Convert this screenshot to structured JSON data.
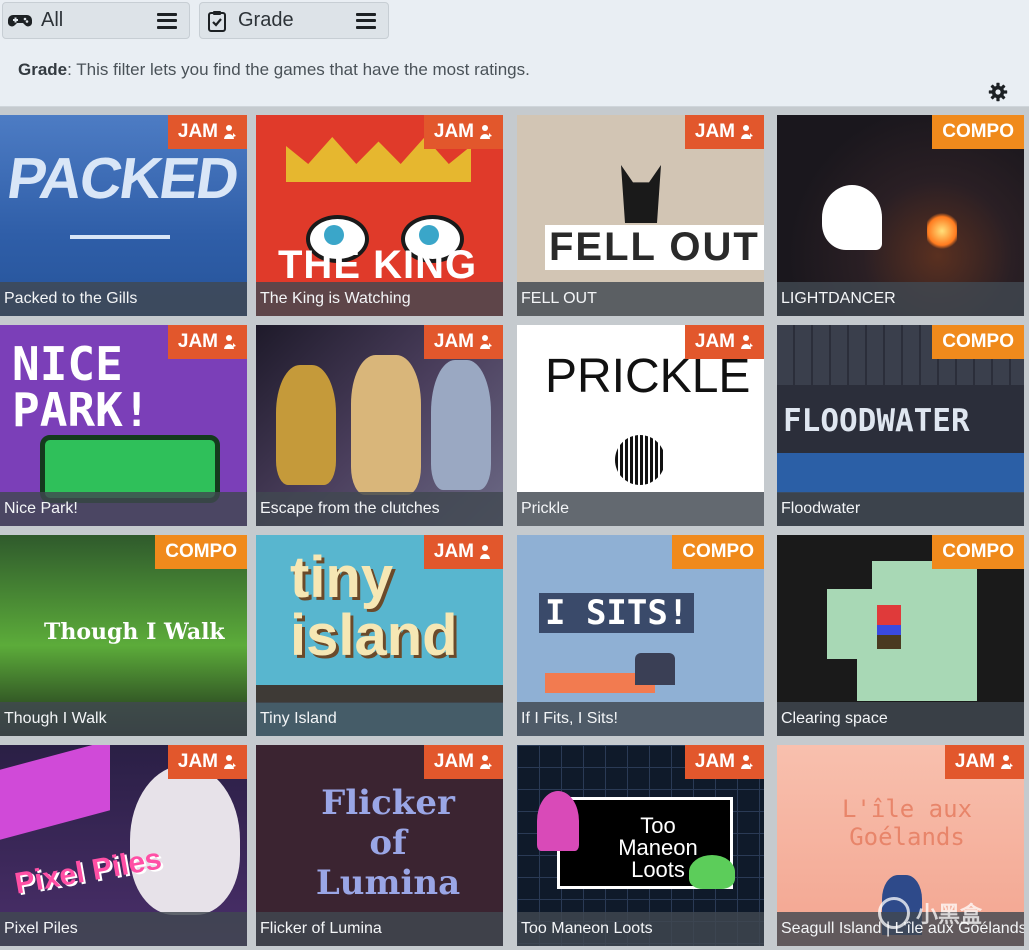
{
  "filters": {
    "platform": {
      "label": "All",
      "icon": "gamepad-icon"
    },
    "sort": {
      "label": "Grade",
      "icon": "clipboard-check-icon"
    }
  },
  "description": {
    "term": "Grade",
    "text": ": This filter lets you find the games that have the most ratings."
  },
  "colors": {
    "jam": "#e2572c",
    "compo": "#f08a1c",
    "caption_bg": "#414850",
    "topbar_bg": "#e9eef3"
  },
  "games": [
    {
      "title": "Packed to the Gills",
      "badge": "JAM",
      "art": "PACKED",
      "bg": "#3e6cb2"
    },
    {
      "title": "The King is Watching",
      "badge": "JAM",
      "art": "THE KING",
      "bg": "#e03a2a"
    },
    {
      "title": "FELL OUT",
      "badge": "JAM",
      "art": "FELL OUT",
      "bg": "#d2c5b4"
    },
    {
      "title": "LIGHTDANCER",
      "badge": "COMPO",
      "art": "",
      "bg": "#1f1a22"
    },
    {
      "title": "Nice Park!",
      "badge": "JAM",
      "art": "NICE PARK!",
      "bg": "#7b3fb8"
    },
    {
      "title": "Escape from the clutches",
      "badge": "JAM",
      "art": "",
      "bg": "#3a3045"
    },
    {
      "title": "Prickle",
      "badge": "JAM",
      "art": "PRICKLE",
      "bg": "#ffffff"
    },
    {
      "title": "Floodwater",
      "badge": "COMPO",
      "art": "FLOODWATER",
      "bg": "#2b2e3a"
    },
    {
      "title": "Though I Walk",
      "badge": "COMPO",
      "art": "Though I Walk",
      "bg": "#1e3b22"
    },
    {
      "title": "Tiny Island",
      "badge": "JAM",
      "art": "tiny island",
      "bg": "#58b6cf"
    },
    {
      "title": "If I Fits, I Sits!",
      "badge": "COMPO",
      "art": "I SITS!",
      "bg": "#8fb0d4"
    },
    {
      "title": "Clearing space",
      "badge": "COMPO",
      "art": "",
      "bg": "#a8d8b5"
    },
    {
      "title": "Pixel Piles",
      "badge": "JAM",
      "art": "Pixel Piles",
      "bg": "#3a2a55"
    },
    {
      "title": "Flicker of Lumina",
      "badge": "JAM",
      "art": "Flicker of Lumina",
      "bg": "#3b2431"
    },
    {
      "title": "Too Maneon Loots",
      "badge": "JAM",
      "art": "Too Maneon Loots",
      "bg": "#0f1a2a"
    },
    {
      "title": "Seagull Island | L'île aux Goélands",
      "badge": "JAM",
      "art": "L'île aux Goélands",
      "bg": "#f6b6a2"
    }
  ],
  "watermark": "小黑盒"
}
